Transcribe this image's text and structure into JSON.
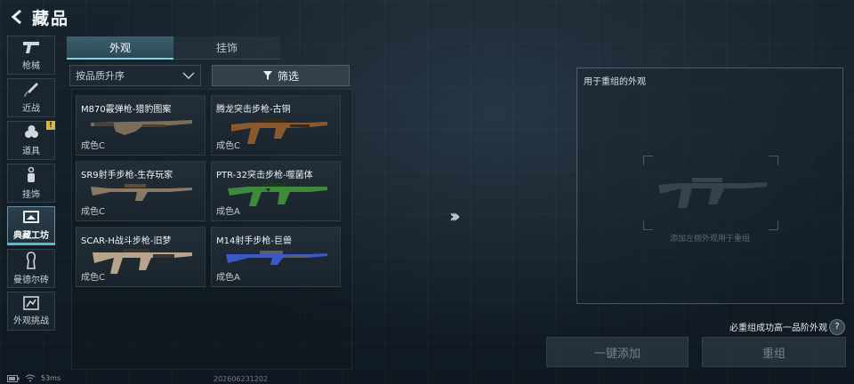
{
  "header": {
    "title": "藏品"
  },
  "sidebar": {
    "items": [
      {
        "label": "枪械",
        "icon": "pistol-icon"
      },
      {
        "label": "近战",
        "icon": "knife-icon"
      },
      {
        "label": "道具",
        "icon": "grenade-icon",
        "badge": "!"
      },
      {
        "label": "挂饰",
        "icon": "charm-icon"
      },
      {
        "label": "典藏工坊",
        "icon": "workshop-icon",
        "active": true
      },
      {
        "label": "曼德尔砖",
        "icon": "brick-icon"
      },
      {
        "label": "外观挑战",
        "icon": "challenge-icon"
      }
    ]
  },
  "tabs": [
    {
      "label": "外观",
      "active": true
    },
    {
      "label": "挂饰",
      "active": false
    }
  ],
  "sort": {
    "label": "按品质升序"
  },
  "filter": {
    "label": "筛选"
  },
  "items": [
    {
      "name": "M870霰弹枪-猎豹图案",
      "grade": "成色C",
      "colors": [
        "#7a6e58",
        "#4a4236"
      ]
    },
    {
      "name": "腾龙突击步枪-古铜",
      "grade": "成色C",
      "colors": [
        "#8a5a2c",
        "#3a2a1c"
      ]
    },
    {
      "name": "SR9射手步枪-生存玩家",
      "grade": "成色C",
      "colors": [
        "#8a7a62",
        "#5a4a38"
      ]
    },
    {
      "name": "PTR-32突击步枪-噬菌体",
      "grade": "成色A",
      "colors": [
        "#3c8a3a",
        "#1e3a1e"
      ]
    },
    {
      "name": "SCAR-H战斗步枪-旧梦",
      "grade": "成色C",
      "colors": [
        "#b8a48a",
        "#3a3530"
      ]
    },
    {
      "name": "M14射手步枪-巨兽",
      "grade": "成色A",
      "colors": [
        "#3a58c8",
        "#5a5f68"
      ]
    }
  ],
  "recombine": {
    "title": "用于重组的外观",
    "hint": "添加左侧外观用于重组"
  },
  "guarantee": {
    "text": "必重组成功高一品阶外观"
  },
  "buttons": {
    "quick_add": "一键添加",
    "recombine": "重组"
  },
  "status": {
    "ping": "53ms",
    "build": "202606231202"
  }
}
